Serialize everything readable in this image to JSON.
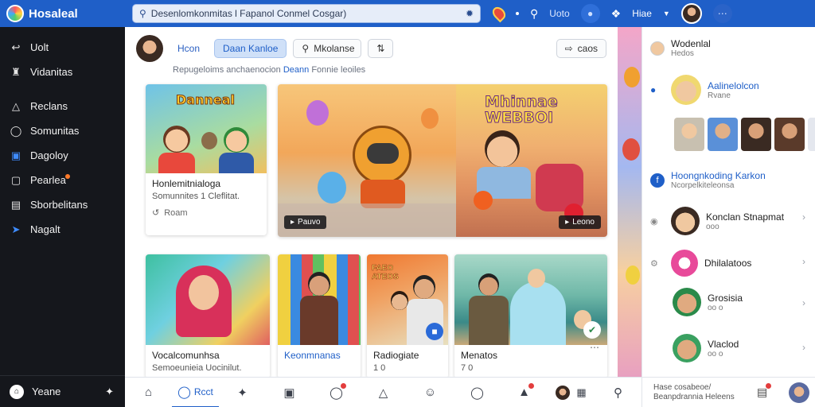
{
  "app": {
    "title": "Hosaleal"
  },
  "search": {
    "value": "Desenlomkonmitas l Fapanol Conmel Cosgar)"
  },
  "topbar": {
    "link": "Uoto",
    "user_label": "Hiae"
  },
  "sidebar": {
    "items": [
      {
        "label": "Uolt",
        "icon": "arrow-icon"
      },
      {
        "label": "Vidanitas",
        "icon": "graduation-cap-icon"
      },
      {
        "label": "Reclans",
        "icon": "bell-icon"
      },
      {
        "label": "Somunitas",
        "icon": "chat-icon"
      },
      {
        "label": "Dagoloy",
        "icon": "app-icon"
      },
      {
        "label": "Pearlea",
        "icon": "window-icon"
      },
      {
        "label": "Sborbelitans",
        "icon": "document-icon"
      },
      {
        "label": "Nagalt",
        "icon": "rocket-icon"
      }
    ],
    "bottom_label": "Yeane"
  },
  "main": {
    "tabs": {
      "home": "Hcon",
      "active": "Daan Kanloe",
      "search_chip": "Mkolanse"
    },
    "right_chip": "caos",
    "breadcrumb": {
      "before": "Repugeloims anchaenocion",
      "highlight": "Deann",
      "after": "Fonnie leoiles"
    },
    "cards": [
      {
        "art_text": "Danneal",
        "title": "Honlemitnialoga",
        "sub": "Somunnites 1 Cleflitat.",
        "meta": "Roam"
      },
      {
        "art_left": "",
        "art_right": "Mhinnae WEBBOI",
        "btn_left": "Pauvo",
        "btn_right": "Leono"
      },
      {
        "title": "Vocalcomunhsa",
        "sub": "Semoeunieia Uocinilut."
      },
      {
        "title": "Keonmnanas",
        "sub": ""
      },
      {
        "art_text": "FAEO ATEOS",
        "title": "Radiogiate",
        "sub": "1 0"
      },
      {
        "title": "Menatos",
        "sub": "7 0"
      }
    ]
  },
  "bottombar": {
    "active_label": "Rcct"
  },
  "rightpanel": {
    "rows": [
      {
        "name": "Wodenlal",
        "sub": "Hedos"
      },
      {
        "name": "Aalinelolcon",
        "sub": "Rvane"
      },
      {
        "name": "Hoongnkoding Karkon",
        "sub": "Ncorpelkiteleonsa"
      },
      {
        "name": "Konclan Stnapmat",
        "sub": "ooo"
      },
      {
        "name": "Dhilalatoos",
        "sub": ""
      },
      {
        "name": "Grosisia",
        "sub": "oo o"
      },
      {
        "name": "Vlaclod",
        "sub": "oo o"
      }
    ],
    "bottom_label": "Hase cosabeoe/ Beanpdrannia Heleens"
  },
  "colors": {
    "accent": "#1f5fc8",
    "sidebar_bg": "#15171c",
    "badge": "#e33d3d"
  }
}
